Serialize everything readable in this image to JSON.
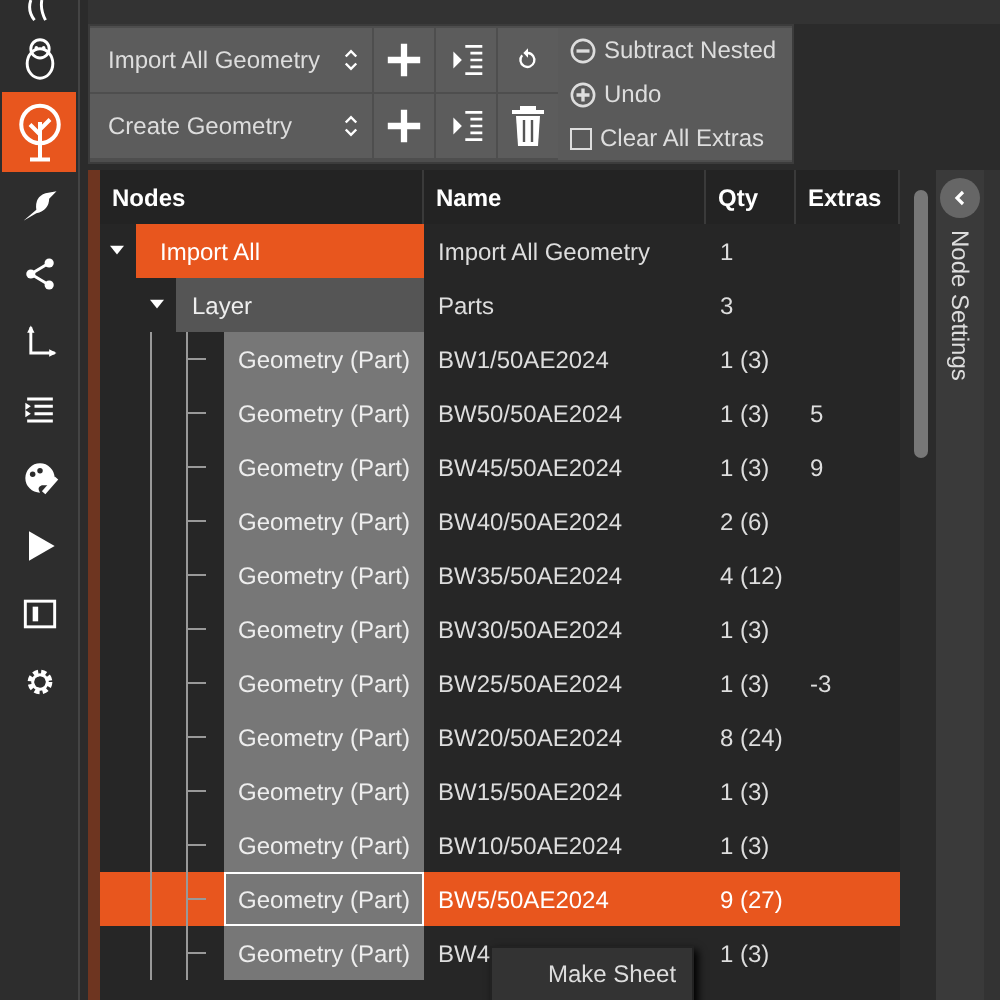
{
  "sidebar": {
    "items": [
      {
        "selected": false
      },
      {
        "selected": false
      },
      {
        "selected": true
      },
      {
        "selected": false
      },
      {
        "selected": false
      },
      {
        "selected": false
      },
      {
        "selected": false
      },
      {
        "selected": false
      },
      {
        "selected": false
      },
      {
        "selected": false
      },
      {
        "selected": false
      }
    ]
  },
  "toolbar": {
    "rows": [
      {
        "combo": "Import All Geometry",
        "kind": "undo"
      },
      {
        "combo": "Create Geometry",
        "kind": "delete"
      }
    ],
    "options": [
      {
        "kind": "minus",
        "label": "Subtract Nested"
      },
      {
        "kind": "plus",
        "label": "Undo"
      },
      {
        "kind": "checkbox",
        "label": "Clear All Extras",
        "checked": false
      }
    ]
  },
  "table": {
    "columns": [
      "Nodes",
      "Name",
      "Qty",
      "Extras"
    ],
    "tree": [
      {
        "kind": "root",
        "label": "Import All",
        "name": "Import All Geometry",
        "qty": "1",
        "expanded": true,
        "selected": false,
        "children": [
          {
            "kind": "layer",
            "label": "Layer",
            "name": "Parts",
            "qty": "3",
            "expanded": true,
            "selected": false,
            "children": [
              {
                "kind": "part",
                "label": "Geometry (Part)",
                "name": "BW1/50AE2024",
                "qty": "1 (3)",
                "selected": false
              },
              {
                "kind": "part",
                "label": "Geometry (Part)",
                "name": "BW50/50AE2024",
                "qty": "1 (3)",
                "extras": "5",
                "selected": false
              },
              {
                "kind": "part",
                "label": "Geometry (Part)",
                "name": "BW45/50AE2024",
                "qty": "1 (3)",
                "extras": "9",
                "selected": false
              },
              {
                "kind": "part",
                "label": "Geometry (Part)",
                "name": "BW40/50AE2024",
                "qty": "2 (6)",
                "selected": false
              },
              {
                "kind": "part",
                "label": "Geometry (Part)",
                "name": "BW35/50AE2024",
                "qty": "4 (12)",
                "selected": false
              },
              {
                "kind": "part",
                "label": "Geometry (Part)",
                "name": "BW30/50AE2024",
                "qty": "1 (3)",
                "selected": false
              },
              {
                "kind": "part",
                "label": "Geometry (Part)",
                "name": "BW25/50AE2024",
                "qty": "1 (3)",
                "extras": "-3",
                "selected": false
              },
              {
                "kind": "part",
                "label": "Geometry (Part)",
                "name": "BW20/50AE2024",
                "qty": "8 (24)",
                "selected": false
              },
              {
                "kind": "part",
                "label": "Geometry (Part)",
                "name": "BW15/50AE2024",
                "qty": "1 (3)",
                "selected": false
              },
              {
                "kind": "part",
                "label": "Geometry (Part)",
                "name": "BW10/50AE2024",
                "qty": "1 (3)",
                "selected": false
              },
              {
                "kind": "part",
                "label": "Geometry (Part)",
                "name": "BW5/50AE2024",
                "qty": "9 (27)",
                "selected": true
              },
              {
                "kind": "part",
                "label": "Geometry (Part)",
                "name": "BW4",
                "qty": "1 (3)",
                "selected": false
              }
            ]
          }
        ]
      }
    ]
  },
  "side_panel": {
    "title": "Node Settings"
  },
  "context_menu": {
    "items": [
      "Make Sheet"
    ]
  }
}
